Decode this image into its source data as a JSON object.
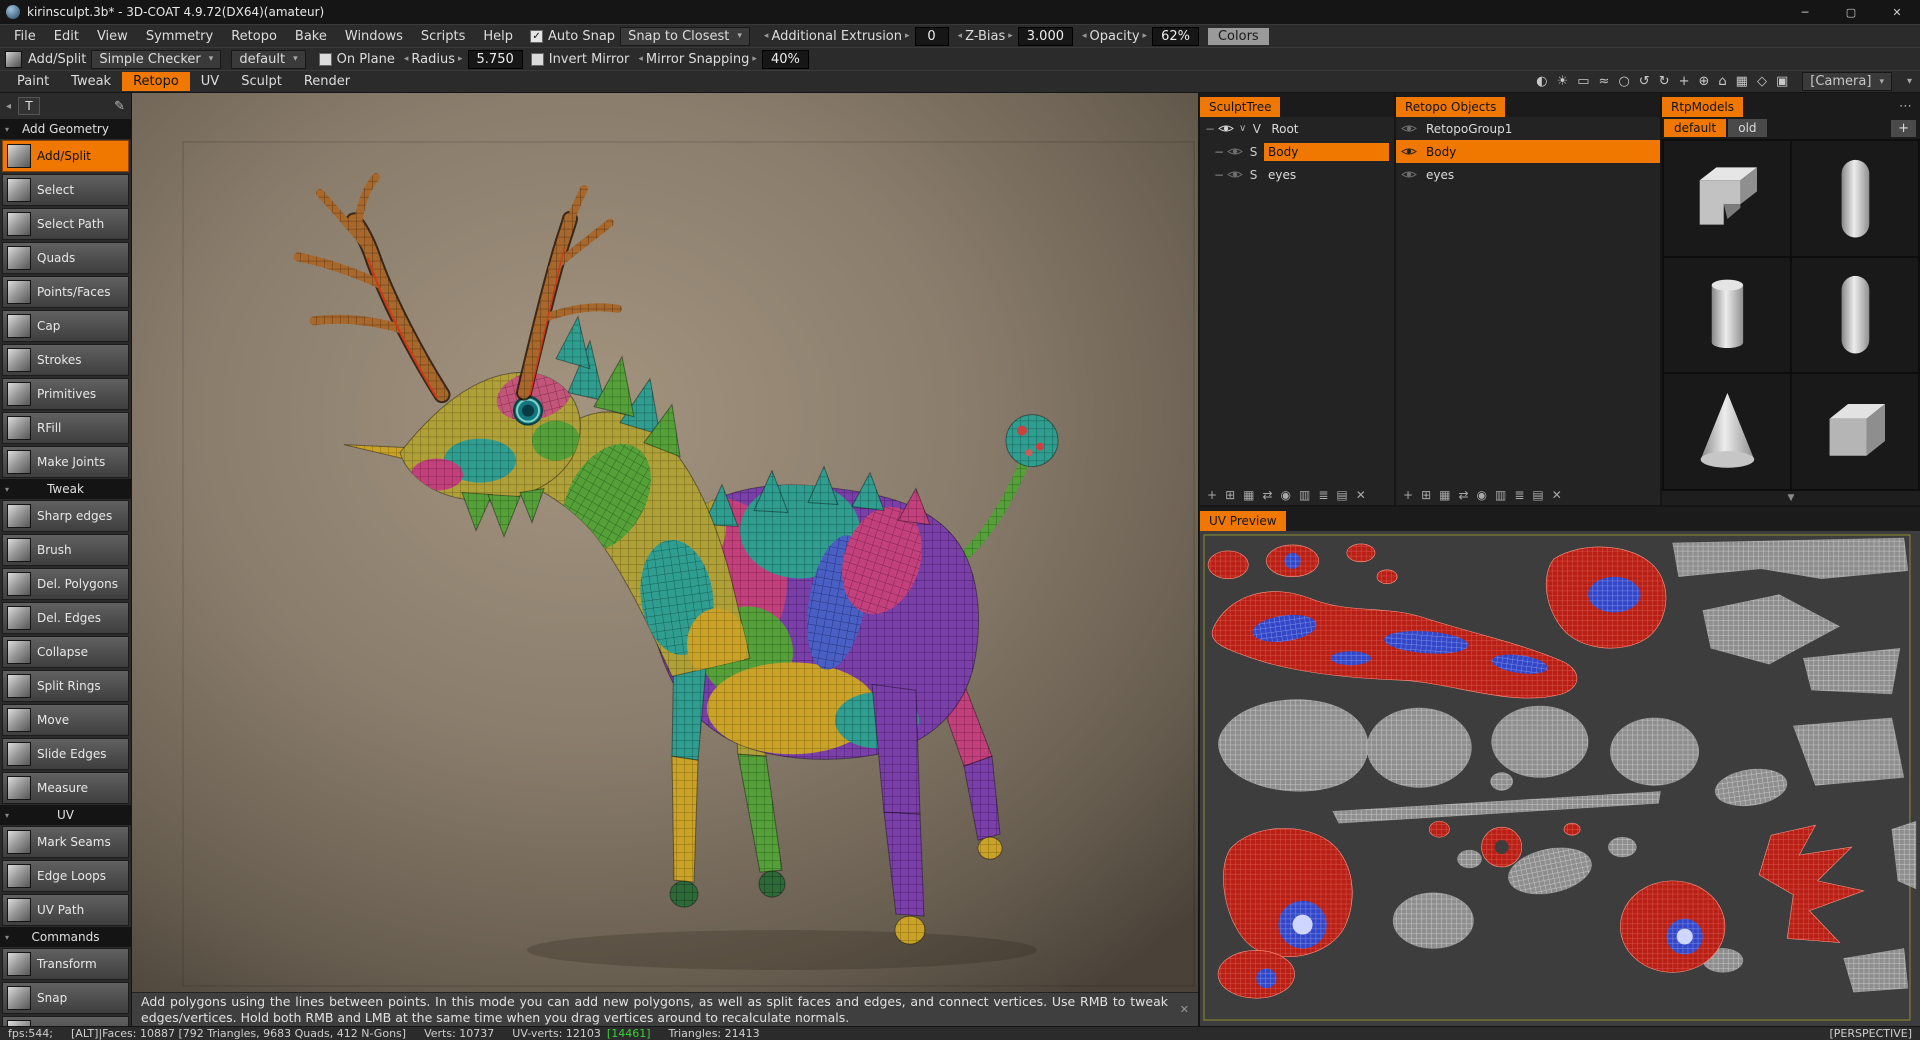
{
  "titlebar": {
    "app_title": "kirinsculpt.3b* - 3D-COAT 4.9.72(DX64)(amateur)"
  },
  "icons": {
    "minimize": "─",
    "maximize": "▢",
    "close": "✕",
    "check": "✓",
    "dropdown": "▾",
    "spin_l": "◂",
    "spin_r": "▸",
    "collapse": "◂",
    "pencil": "✎",
    "dots": "⋯",
    "plus": "+",
    "scroll": "▼",
    "minus": "−",
    "caret": "∨",
    "grip": "✕",
    "tri": "▾"
  },
  "menubar": {
    "items": [
      "File",
      "Edit",
      "View",
      "Symmetry",
      "Retopo",
      "Bake",
      "Windows",
      "Scripts",
      "Help"
    ],
    "auto_snap": "Auto Snap",
    "snap_to": "Snap to Closest",
    "spinners": [
      {
        "label": "Additional Extrusion",
        "value": "0"
      },
      {
        "label": "Z-Bias",
        "value": "3.000"
      },
      {
        "label": "Opacity",
        "value": "62%"
      }
    ],
    "colors_button": "Colors"
  },
  "toolbar": {
    "tool": "Add/Split",
    "checker": "Simple Checker",
    "preset": "default",
    "on_plane": "On Plane",
    "radius": {
      "label": "Radius",
      "value": "5.750"
    },
    "invert_mirror": "Invert Mirror",
    "mirror_snapping": {
      "label": "Mirror Snapping",
      "value": "40%"
    }
  },
  "tabbar": {
    "tabs": [
      "Paint",
      "Tweak",
      "Retopo",
      "UV",
      "Sculpt",
      "Render"
    ],
    "active_tab": "Retopo",
    "view_icons": [
      "◐",
      "☀",
      "▭",
      "≈",
      "○",
      "↺",
      "↻",
      "+",
      "⊕",
      "⌂",
      "▦",
      "◇",
      "▣"
    ],
    "camera": "[Camera]"
  },
  "sidebar": {
    "text_tool": "T",
    "sections": [
      {
        "title": "Add Geometry",
        "tools": [
          "Add/Split",
          "Select",
          "Select Path",
          "Quads",
          "Points/Faces",
          "Cap",
          "Strokes",
          "Primitives",
          "RFill",
          "Make Joints"
        ]
      },
      {
        "title": "Tweak",
        "tools": [
          "Sharp edges",
          "Brush",
          "Del. Polygons",
          "Del. Edges",
          "Collapse",
          "Split Rings",
          "Move",
          "Slide Edges",
          "Measure"
        ]
      },
      {
        "title": "UV",
        "tools": [
          "Mark Seams",
          "Edge Loops",
          "UV Path"
        ]
      },
      {
        "title": "Commands",
        "tools": [
          "Transform",
          "Snap"
        ]
      }
    ],
    "active_tool": "Add/Split"
  },
  "panels": {
    "sculpt_tree": {
      "title": "SculptTree",
      "rows": [
        {
          "badge": "V",
          "label": "Root",
          "selected": false
        },
        {
          "badge": "S",
          "label": "Body",
          "selected": true
        },
        {
          "badge": "S",
          "label": "eyes",
          "selected": false
        }
      ]
    },
    "retopo_objects": {
      "title": "Retopo Objects",
      "rows": [
        {
          "label": "RetopoGroup1",
          "selected": false
        },
        {
          "label": "Body",
          "selected": true
        },
        {
          "label": "eyes",
          "selected": false
        }
      ]
    },
    "rtp_models": {
      "title": "RtpModels",
      "tabs": [
        "default",
        "old"
      ],
      "active_tab": "default",
      "shapes": [
        "corner",
        "capsule",
        "cylinder",
        "capsule",
        "cone",
        "cube"
      ]
    },
    "uv_preview": {
      "title": "UV Preview"
    },
    "toolbar_icons": [
      "+",
      "⊞",
      "▦",
      "⇄",
      "◉",
      "▥",
      "≣",
      "▤",
      "✕"
    ]
  },
  "viewport": {
    "help_text": "Add polygons using the lines between points. In this mode you can add new polygons, as well as split faces and edges, and connect vertices. Use RMB to tweak edges/vertices. Hold both RMB and LMB at the same time when you drag vertices around to recalculate normals."
  },
  "statusbar": {
    "fps": "fps:544;",
    "faces": "[ALT]|Faces: 10887 [792 Triangles, 9683 Quads, 412 N-Gons]",
    "verts": "Verts: 10737",
    "uv_verts": "UV-verts: 12103",
    "uv_extra": "[14461]",
    "triangles": "Triangles: 21413",
    "projection": "[PERSPECTIVE]"
  },
  "colors": {
    "accent": "#f07800",
    "selection_green": "#3ad23a",
    "viewport_bg": "#8d8070",
    "uv_background": "#3d3d3d"
  }
}
